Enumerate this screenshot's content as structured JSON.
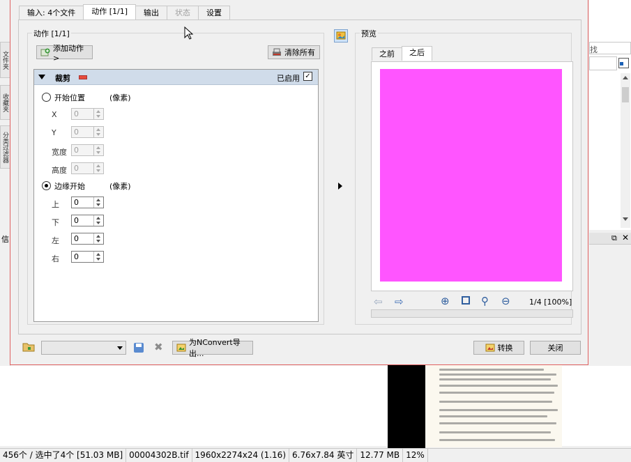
{
  "app": {
    "side_tabs": [
      "文件夹",
      "收藏夹",
      "分类过滤器"
    ],
    "panel_label": "信",
    "search_fragment": "找",
    "statusbar": [
      "456个 / 选中了4个 [51.03 MB]",
      "00004302B.tif",
      "1960x2274x24 (1.16)",
      "6.76x7.84 英寸",
      "12.77 MB",
      "12%"
    ]
  },
  "dialog": {
    "tabs": [
      {
        "label": "输入: 4个文件",
        "state": "normal"
      },
      {
        "label": "动作 [1/1]",
        "state": "active"
      },
      {
        "label": "输出",
        "state": "normal"
      },
      {
        "label": "状态",
        "state": "disabled"
      },
      {
        "label": "设置",
        "state": "normal"
      }
    ],
    "actions_group_title": "动作 [1/1]",
    "add_action_label": "添加动作>",
    "clear_all_label": "清除所有",
    "crop": {
      "title": "裁剪",
      "enabled_label": "已启用",
      "enabled": true,
      "mode_start_label": "开始位置",
      "mode_start_unit": "(像素)",
      "mode_margin_label": "边缘开始",
      "mode_margin_unit": "(像素)",
      "selected_mode": "margin",
      "start_fields": [
        {
          "label": "X",
          "value": "0"
        },
        {
          "label": "Y",
          "value": "0"
        },
        {
          "label": "宽度",
          "value": "0"
        },
        {
          "label": "高度",
          "value": "0"
        }
      ],
      "margin_fields": [
        {
          "label": "上",
          "value": "0"
        },
        {
          "label": "下",
          "value": "0"
        },
        {
          "label": "左",
          "value": "0"
        },
        {
          "label": "右",
          "value": "0"
        }
      ]
    },
    "preview": {
      "group_title": "预览",
      "tab_before": "之前",
      "tab_after": "之后",
      "page_indicator": "1/4 [100%]",
      "image_color": "#ff55ff"
    },
    "export_label": "为NConvert导出...",
    "convert_label": "转换",
    "close_label": "关闭"
  }
}
